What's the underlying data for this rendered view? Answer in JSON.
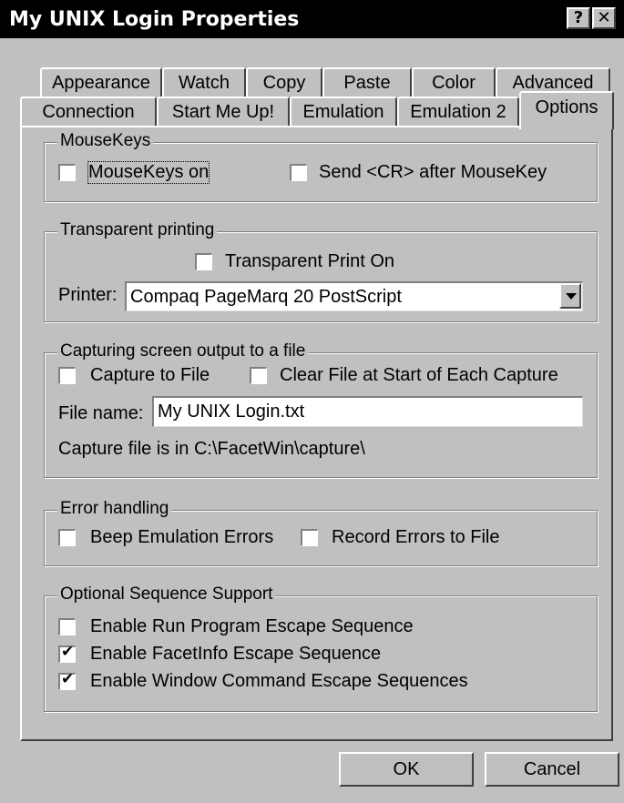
{
  "window": {
    "title": "My UNIX Login Properties",
    "help_label": "?",
    "close_label": "✕"
  },
  "tabs": {
    "row1": [
      "Appearance",
      "Watch",
      "Copy",
      "Paste",
      "Color",
      "Advanced"
    ],
    "row2": [
      "Connection",
      "Start Me Up!",
      "Emulation",
      "Emulation 2",
      "Options"
    ],
    "active": "Options"
  },
  "mousekeys": {
    "legend": "MouseKeys",
    "on_label": "MouseKeys on",
    "on_checked": false,
    "send_cr_label": "Send <CR> after MouseKey",
    "send_cr_checked": false
  },
  "transparent": {
    "legend": "Transparent printing",
    "print_on_label": "Transparent Print On",
    "print_on_checked": false,
    "printer_label": "Printer:",
    "printer_value": "Compaq PageMarq 20 PostScript"
  },
  "capture": {
    "legend": "Capturing screen output to a file",
    "capture_label": "Capture to File",
    "capture_checked": false,
    "clear_label": "Clear File at Start of Each Capture",
    "clear_checked": false,
    "file_name_label": "File name:",
    "file_name_value": "My UNIX Login.txt",
    "location_text": "Capture file is in C:\\FacetWin\\capture\\"
  },
  "errors": {
    "legend": "Error handling",
    "beep_label": "Beep Emulation Errors",
    "beep_checked": false,
    "record_label": "Record Errors to File",
    "record_checked": false
  },
  "sequences": {
    "legend": "Optional Sequence Support",
    "run_program_label": "Enable Run Program Escape Sequence",
    "run_program_checked": false,
    "facetinfo_label": "Enable FacetInfo Escape Sequence",
    "facetinfo_checked": true,
    "window_cmd_label": "Enable Window Command Escape Sequences",
    "window_cmd_checked": true
  },
  "buttons": {
    "ok": "OK",
    "cancel": "Cancel"
  }
}
